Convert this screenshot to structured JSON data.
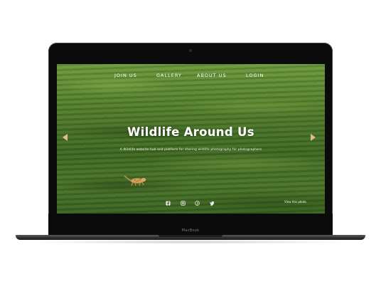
{
  "device": {
    "brand_label": "MacBook"
  },
  "nav": {
    "items": [
      {
        "label": "JOIN US"
      },
      {
        "label": "GALLERY"
      },
      {
        "label": "ABOUT US"
      },
      {
        "label": "LOGIN"
      }
    ]
  },
  "hero": {
    "title": "Wildlife Around Us",
    "subtitle": "A Wildlife website hub and platform for sharing wildlife photography for photographers"
  },
  "carousel": {
    "prev_icon": "arrow-left-icon",
    "next_icon": "arrow-right-icon",
    "accent_color": "#e2b898"
  },
  "socials": {
    "icons": [
      "facebook-icon",
      "instagram-icon",
      "pinterest-icon",
      "twitter-icon"
    ]
  },
  "footer": {
    "photo_link": "View this photo"
  }
}
